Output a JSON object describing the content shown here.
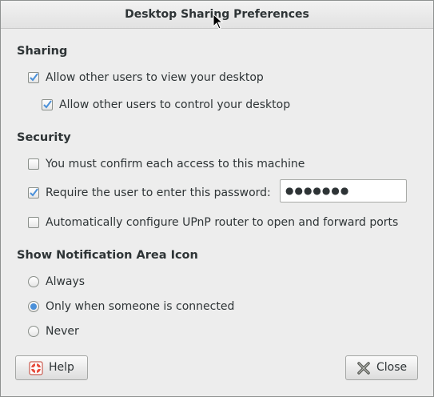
{
  "window": {
    "title": "Desktop Sharing Preferences"
  },
  "sharing": {
    "heading": "Sharing",
    "allow_view": {
      "label": "Allow other users to view your desktop",
      "checked": true
    },
    "allow_control": {
      "label": "Allow other users to control your desktop",
      "checked": true
    }
  },
  "security": {
    "heading": "Security",
    "confirm_access": {
      "label": "You must confirm each access to this machine",
      "checked": false
    },
    "require_password": {
      "label": "Require the user to enter this password:",
      "checked": true
    },
    "password_value": "●●●●●●●",
    "upnp": {
      "label": "Automatically configure UPnP router to open and forward ports",
      "checked": false
    }
  },
  "notification": {
    "heading": "Show Notification Area Icon",
    "options": [
      {
        "label": "Always",
        "selected": false
      },
      {
        "label": "Only when someone is connected",
        "selected": true
      },
      {
        "label": "Never",
        "selected": false
      }
    ]
  },
  "buttons": {
    "help_label": "Help",
    "close_label": "Close"
  },
  "colors": {
    "accent": "#4a90d9",
    "window_bg": "#ededed"
  },
  "icons": {
    "help": "help-lifebuoy-icon",
    "close": "close-x-icon",
    "check": "checkmark-icon"
  }
}
